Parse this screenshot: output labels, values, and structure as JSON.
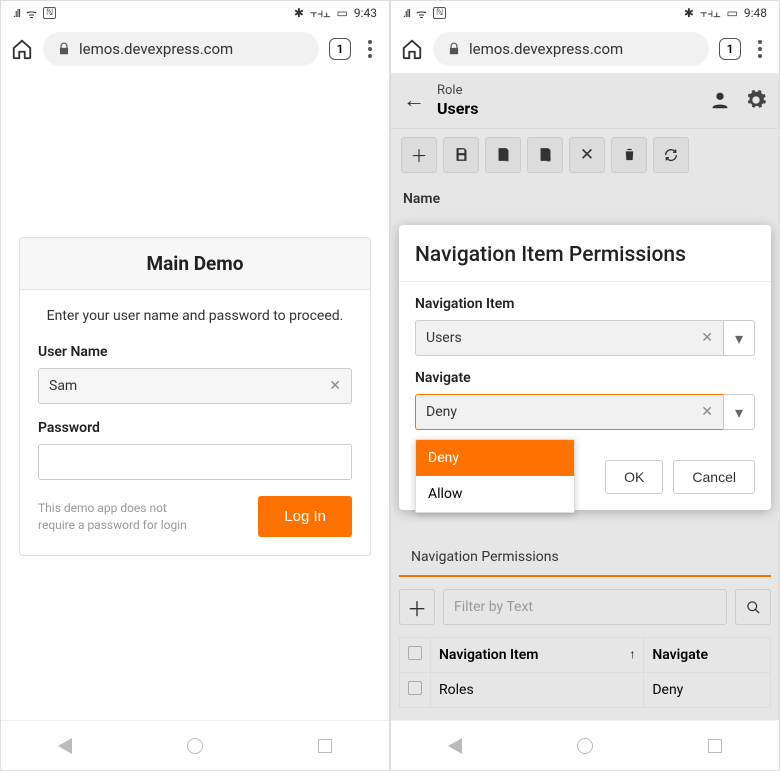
{
  "left": {
    "status_time": "9:43",
    "url": "lemos.devexpress.com",
    "tab_count": "1",
    "login": {
      "title": "Main Demo",
      "prompt": "Enter your user name and password to proceed.",
      "username_label": "User Name",
      "username_value": "Sam",
      "password_label": "Password",
      "password_value": "",
      "hint": "This demo app does not require a password for login",
      "login_button": "Log In"
    }
  },
  "right": {
    "status_time": "9:48",
    "url": "lemos.devexpress.com",
    "tab_count": "1",
    "header": {
      "breadcrumb": "Role",
      "title": "Users"
    },
    "name_label": "Name",
    "modal": {
      "title": "Navigation Item Permissions",
      "nav_item_label": "Navigation Item",
      "nav_item_value": "Users",
      "navigate_label": "Navigate",
      "navigate_value": "Deny",
      "options": {
        "deny": "Deny",
        "allow": "Allow"
      },
      "ok": "OK",
      "cancel": "Cancel"
    },
    "tabs": {
      "nav_perm": "Navigation Permissions"
    },
    "filter_placeholder": "Filter by Text",
    "table": {
      "col1": "Navigation Item",
      "col2": "Navigate",
      "row1_c1": "Roles",
      "row1_c2": "Deny"
    }
  }
}
